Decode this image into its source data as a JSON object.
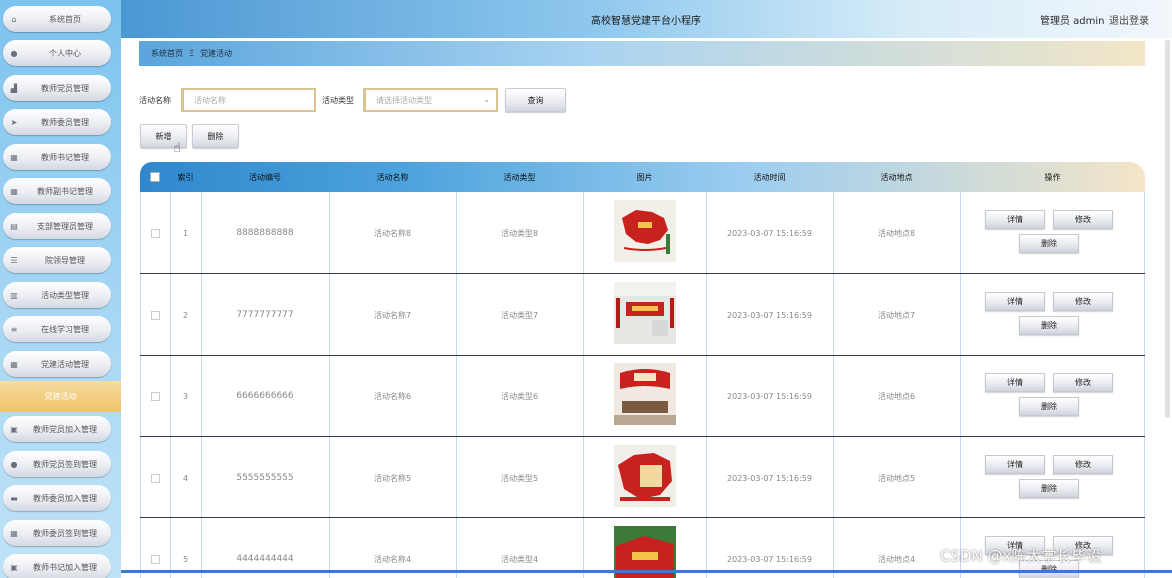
{
  "header": {
    "title": "高校智慧党建平台小程序",
    "user": "管理员 admin",
    "logout": "退出登录"
  },
  "sidebar": {
    "items": [
      {
        "label": "系统首页",
        "icon": "home-icon"
      },
      {
        "label": "个人中心",
        "icon": "user-icon"
      },
      {
        "label": "教师党员管理",
        "icon": "chart-icon"
      },
      {
        "label": "教师委员管理",
        "icon": "send-icon"
      },
      {
        "label": "教师书记管理",
        "icon": "grid-icon"
      },
      {
        "label": "教师副书记管理",
        "icon": "grid-icon"
      },
      {
        "label": "支部管理员管理",
        "icon": "table-icon"
      },
      {
        "label": "院领导管理",
        "icon": "list-icon"
      },
      {
        "label": "活动类型管理",
        "icon": "bar-icon"
      },
      {
        "label": "在线学习管理",
        "icon": "menu-icon"
      },
      {
        "label": "党建活动管理",
        "icon": "grid-icon"
      }
    ],
    "active": "党建活动",
    "sub_items": [
      {
        "label": "教师党员加入管理",
        "icon": "doc-icon"
      },
      {
        "label": "教师党员签到管理",
        "icon": "user-icon"
      },
      {
        "label": "教师委员加入管理",
        "icon": "card-icon"
      },
      {
        "label": "教师委员签到管理",
        "icon": "grid-icon"
      },
      {
        "label": "教师书记加入管理",
        "icon": "doc-icon"
      }
    ]
  },
  "breadcrumb": {
    "home": "系统首页",
    "sep": "Ξ",
    "current": "党建活动"
  },
  "search": {
    "name_label": "活动名称",
    "name_placeholder": "活动名称",
    "type_label": "活动类型",
    "type_placeholder": "请选择活动类型",
    "query_button": "查询"
  },
  "actions": {
    "add": "新增",
    "delete": "删除"
  },
  "table": {
    "columns": [
      "索引",
      "活动编号",
      "活动名称",
      "活动类型",
      "图片",
      "活动时间",
      "活动地点",
      "操作"
    ],
    "rows": [
      {
        "index": "1",
        "code": "8888888888",
        "name": "活动名称8",
        "type": "活动类型8",
        "time": "2023-03-07 15:16:59",
        "place": "活动地点8"
      },
      {
        "index": "2",
        "code": "7777777777",
        "name": "活动名称7",
        "type": "活动类型7",
        "time": "2023-03-07 15:16:59",
        "place": "活动地点7"
      },
      {
        "index": "3",
        "code": "6666666666",
        "name": "活动名称6",
        "type": "活动类型6",
        "time": "2023-03-07 15:16:59",
        "place": "活动地点6"
      },
      {
        "index": "4",
        "code": "5555555555",
        "name": "活动名称5",
        "type": "活动类型5",
        "time": "2023-03-07 15:16:59",
        "place": "活动地点5"
      },
      {
        "index": "5",
        "code": "4444444444",
        "name": "活动名称4",
        "type": "活动类型4",
        "time": "2023-03-07 15:16:59",
        "place": "活动地点4"
      }
    ],
    "op_labels": {
      "detail": "详情",
      "edit": "修改",
      "delete": "删除"
    }
  },
  "watermark": "CSDN @x陈太学长毕设",
  "colors": {
    "accent_blue": "#4b97d3",
    "accent_gold": "#efc26a",
    "flag_red": "#c8221e"
  }
}
